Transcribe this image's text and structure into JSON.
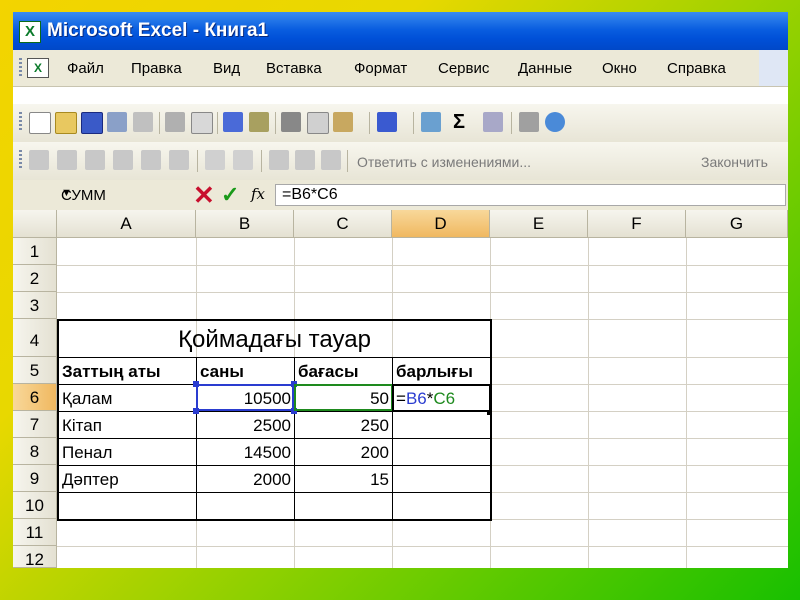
{
  "window": {
    "title": "Microsoft Excel - Книга1",
    "app_icon": "excel-icon"
  },
  "menubar": {
    "items": [
      {
        "label": "Файл"
      },
      {
        "label": "Правка"
      },
      {
        "label": "Вид"
      },
      {
        "label": "Вставка"
      },
      {
        "label": "Формат"
      },
      {
        "label": "Сервис"
      },
      {
        "label": "Данные"
      },
      {
        "label": "Окно"
      },
      {
        "label": "Справка"
      }
    ]
  },
  "toolbar2": {
    "reply_label": "Ответить с изменениями...",
    "finish_label": "Закончить"
  },
  "formulabar": {
    "namebox": "СУММ",
    "formula": "=B6*C6"
  },
  "columns": [
    "A",
    "B",
    "C",
    "D",
    "E",
    "F",
    "G"
  ],
  "rows": [
    "1",
    "2",
    "3",
    "4",
    "5",
    "6",
    "7",
    "8",
    "9",
    "10",
    "11",
    "12"
  ],
  "sheet": {
    "title": "Қоймадағы тауар",
    "headers": [
      "Заттың аты",
      "саны",
      "бағасы",
      "барлығы"
    ],
    "records": [
      {
        "name": "Қалам",
        "qty": "10500",
        "price": "50"
      },
      {
        "name": "Кітап",
        "qty": "2500",
        "price": "250"
      },
      {
        "name": "Пенал",
        "qty": "14500",
        "price": "200"
      },
      {
        "name": "Дәптер",
        "qty": "2000",
        "price": "15"
      }
    ],
    "edit_cell": {
      "eq": "=",
      "ref1": "B6",
      "op": "*",
      "ref2": "C6"
    }
  },
  "colors": {
    "ref1": "#2a3cd0",
    "ref2": "#1e8a1e",
    "selection": "#f0b860"
  }
}
